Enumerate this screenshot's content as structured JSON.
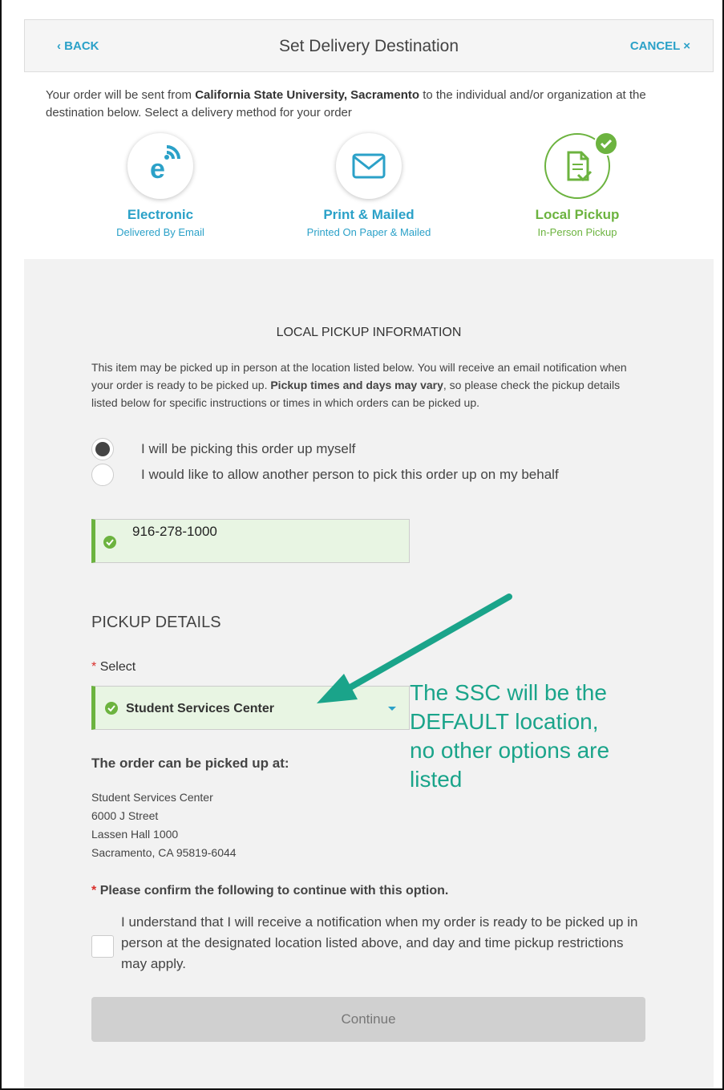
{
  "header": {
    "back_label": "‹ BACK",
    "title": "Set Delivery Destination",
    "cancel_label": "CANCEL ×"
  },
  "intro": {
    "prefix": "Your order will be sent from ",
    "institution": "California State University, Sacramento",
    "suffix": " to the individual and/or organization at the destination below. Select a delivery method for your order"
  },
  "methods": [
    {
      "name": "Electronic",
      "sub": "Delivered By Email",
      "icon": "electronic-icon",
      "selected": false
    },
    {
      "name": "Print & Mailed",
      "sub": "Printed On Paper & Mailed",
      "icon": "envelope-icon",
      "selected": false
    },
    {
      "name": "Local Pickup",
      "sub": "In-Person Pickup",
      "icon": "document-pickup-icon",
      "selected": true
    }
  ],
  "pickup_info": {
    "title": "LOCAL PICKUP INFORMATION",
    "text_1": "This item may be picked up in person at the location listed below. You will receive an email notification when your order is ready to be picked up. ",
    "text_bold": "Pickup times and days may vary",
    "text_2": ", so please check the pickup details listed below for specific instructions or times in which orders can be picked up.",
    "options": [
      {
        "label": "I will be picking this order up myself",
        "selected": true
      },
      {
        "label": "I would like to allow another person to pick this order up on my behalf",
        "selected": false
      }
    ],
    "phone_value": "916-278-1000"
  },
  "pickup_details": {
    "title": "PICKUP DETAILS",
    "select_label": "Select",
    "selected_location": "Student Services Center",
    "picked_up_at_label": "The order can be picked up at:",
    "address": [
      "Student Services Center",
      "6000 J Street",
      "Lassen Hall 1000",
      "Sacramento, CA 95819-6044"
    ],
    "confirm_label": "Please confirm the following to continue with this option.",
    "confirm_text": "I understand that I will receive a notification when my order is ready to be picked up in person at the designated location listed above, and day and time pickup restrictions may apply.",
    "continue_label": "Continue"
  },
  "annotation": {
    "text": "The SSC will be the DEFAULT location, no other options are listed",
    "color": "#1aa48a"
  },
  "colors": {
    "accent_blue": "#2ba1c8",
    "accent_green": "#6cb33f",
    "required_red": "#d9302c"
  }
}
